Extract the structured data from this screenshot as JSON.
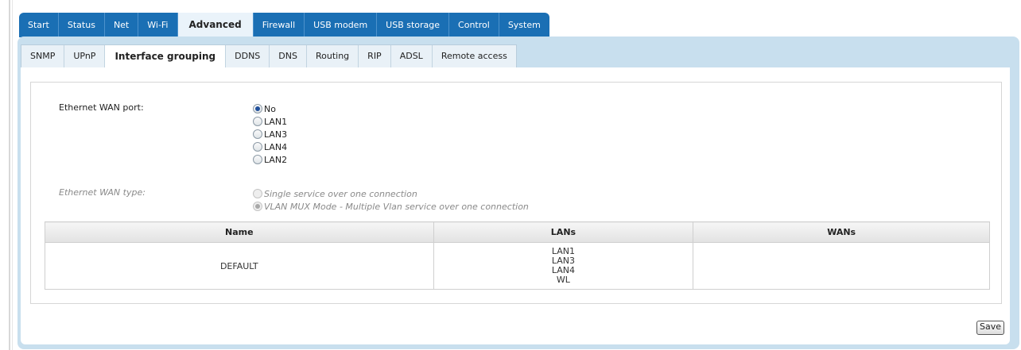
{
  "main_tabs": [
    "Start",
    "Status",
    "Net",
    "Wi-Fi",
    "Advanced",
    "Firewall",
    "USB modem",
    "USB storage",
    "Control",
    "System"
  ],
  "active_main_tab": "Advanced",
  "sub_tabs": [
    "SNMP",
    "UPnP",
    "Interface grouping",
    "DDNS",
    "DNS",
    "Routing",
    "RIP",
    "ADSL",
    "Remote access"
  ],
  "active_sub_tab": "Interface grouping",
  "ethernet_wan_port": {
    "label": "Ethernet WAN port:",
    "options": [
      "No",
      "LAN1",
      "LAN3",
      "LAN4",
      "LAN2"
    ],
    "selected": "No"
  },
  "ethernet_wan_type": {
    "label": "Ethernet WAN type:",
    "options": [
      "Single service over one connection",
      "VLAN MUX Mode - Multiple Vlan service over one connection"
    ],
    "selected": "VLAN MUX Mode - Multiple Vlan service over one connection",
    "disabled": true
  },
  "groups_table": {
    "headers": [
      "Name",
      "LANs",
      "WANs"
    ],
    "rows": [
      {
        "name": "DEFAULT",
        "lans": [
          "LAN1",
          "LAN3",
          "LAN4",
          "WL"
        ],
        "wans": ""
      }
    ]
  },
  "save_label": "Save",
  "colors": {
    "tab_bar": "#1a6fb4",
    "frame": "#c8dfee",
    "radio_checked": "#1f4f9b"
  }
}
